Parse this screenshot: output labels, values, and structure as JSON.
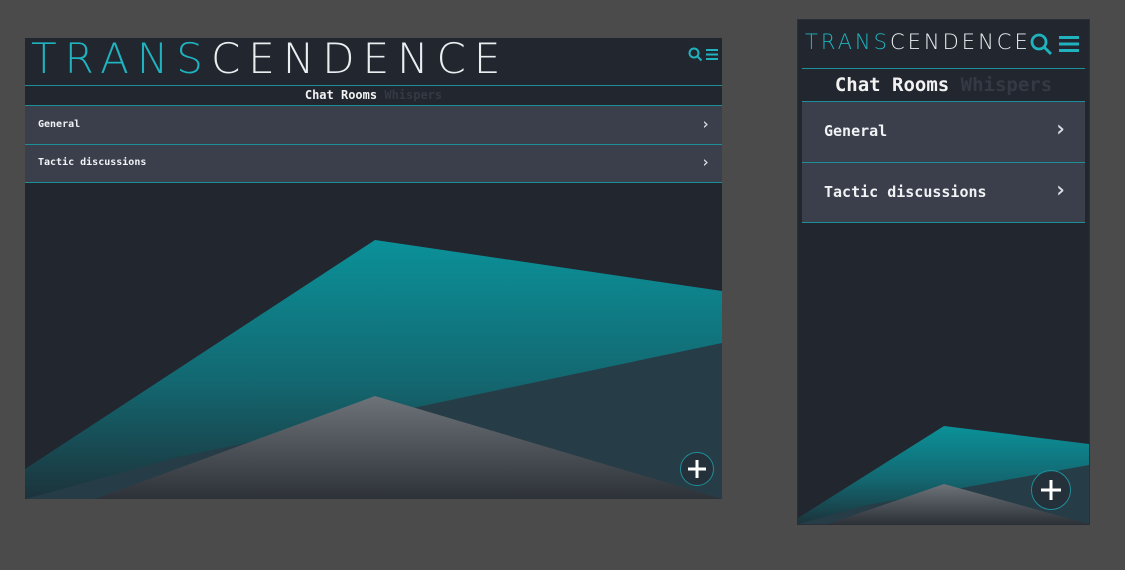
{
  "app": {
    "logo_left": "TRAN",
    "logo_s": "S",
    "logo_right": "CENDENCE"
  },
  "tabs": [
    {
      "label": "Chat Rooms",
      "active": true
    },
    {
      "label": "Whispers",
      "active": false
    }
  ],
  "rooms": [
    {
      "name": "General"
    },
    {
      "name": "Tactic discussions"
    }
  ],
  "icons": {
    "search": "search-icon",
    "menu": "hamburger-menu-icon",
    "chevron": "chevron-right-icon",
    "add": "plus-icon"
  },
  "chevron_glyph": "›",
  "colors": {
    "background": "#4b4b4b",
    "panel": "#22262f",
    "row": "#3a3f4b",
    "accent": "#1fb3bf",
    "divider": "#1e8f99"
  }
}
